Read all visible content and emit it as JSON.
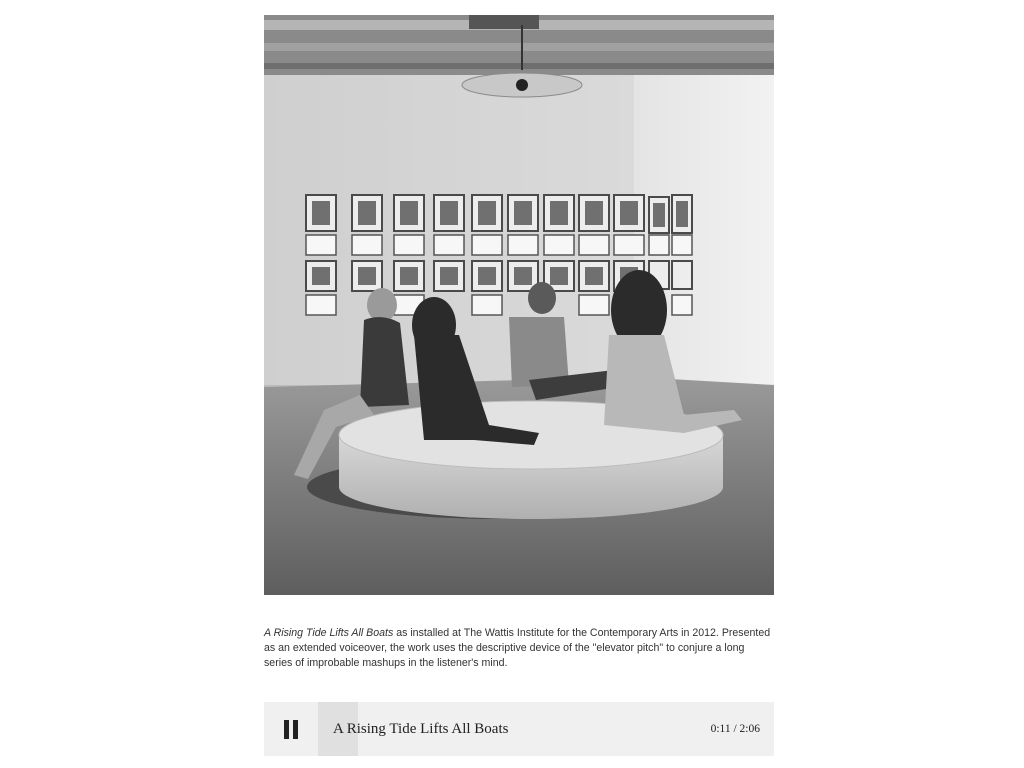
{
  "caption": {
    "work_title": "A Rising Tide Lifts All Boats",
    "text": " as installed at The Wattis Institute for the Contemporary Arts in 2012. Presented as an extended voiceover, the work uses the descriptive device of the \"elevator pitch\" to conjure a long series of improbable mashups in the listener's mind."
  },
  "player": {
    "state": "playing",
    "control_icon": "pause-icon",
    "track_title": "A Rising Tide Lifts All Boats",
    "current_time": "0:11",
    "separator": " / ",
    "duration": "2:06",
    "progress_fraction": 0.087
  },
  "colors": {
    "player_background": "#f0f0f0",
    "progress_fill": "#e0e0e0",
    "text": "#333333"
  }
}
